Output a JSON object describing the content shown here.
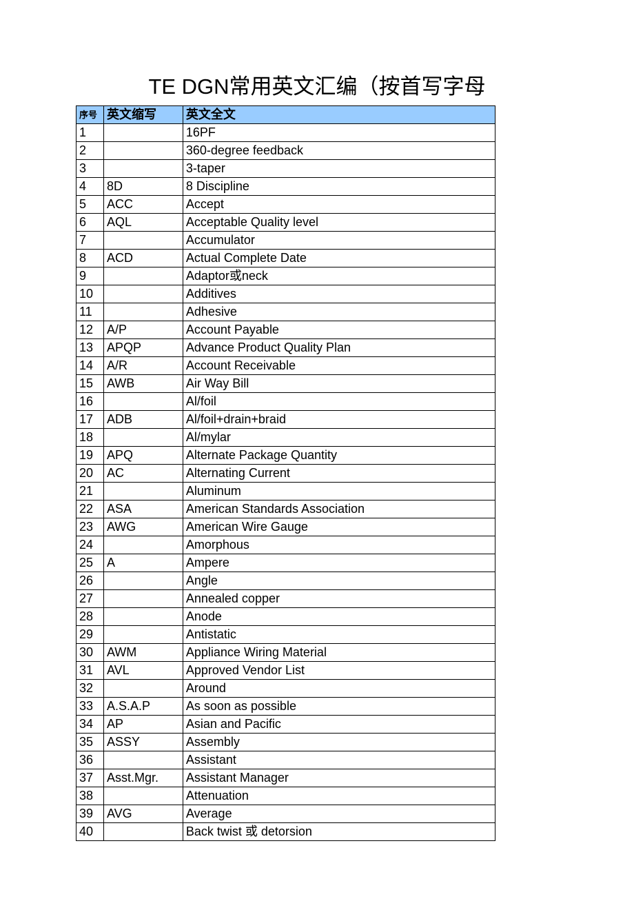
{
  "title": "TE DGN常用英文汇编（按首写字母",
  "headers": {
    "seq": "序号",
    "abbr": "英文缩写",
    "full": "英文全文"
  },
  "rows": [
    {
      "seq": "1",
      "abbr": "",
      "full": "16PF"
    },
    {
      "seq": "2",
      "abbr": "",
      "full": "360-degree feedback"
    },
    {
      "seq": "3",
      "abbr": "",
      "full": "3-taper"
    },
    {
      "seq": "4",
      "abbr": "8D",
      "full": "8 Discipline"
    },
    {
      "seq": "5",
      "abbr": "ACC",
      "full": "Accept"
    },
    {
      "seq": "6",
      "abbr": "AQL",
      "full": "Acceptable Quality level"
    },
    {
      "seq": "7",
      "abbr": "",
      "full": "Accumulator"
    },
    {
      "seq": "8",
      "abbr": "ACD",
      "full": "Actual Complete Date"
    },
    {
      "seq": "9",
      "abbr": "",
      "full": "Adaptor或neck"
    },
    {
      "seq": "10",
      "abbr": "",
      "full": "Additives"
    },
    {
      "seq": "11",
      "abbr": "",
      "full": "Adhesive"
    },
    {
      "seq": "12",
      "abbr": "A/P",
      "full": "Account Payable"
    },
    {
      "seq": "13",
      "abbr": "APQP",
      "full": "Advance Product Quality Plan"
    },
    {
      "seq": "14",
      "abbr": "A/R",
      "full": "Account Receivable"
    },
    {
      "seq": "15",
      "abbr": "AWB",
      "full": "Air Way Bill"
    },
    {
      "seq": "16",
      "abbr": "",
      "full": "Al/foil"
    },
    {
      "seq": "17",
      "abbr": "ADB",
      "full": "Al/foil+drain+braid"
    },
    {
      "seq": "18",
      "abbr": "",
      "full": "Al/mylar"
    },
    {
      "seq": "19",
      "abbr": "APQ",
      "full": "Alternate Package Quantity"
    },
    {
      "seq": "20",
      "abbr": "AC",
      "full": "Alternating Current"
    },
    {
      "seq": "21",
      "abbr": "",
      "full": "Aluminum"
    },
    {
      "seq": "22",
      "abbr": "ASA",
      "full": "American Standards Association"
    },
    {
      "seq": "23",
      "abbr": "AWG",
      "full": "American Wire Gauge"
    },
    {
      "seq": "24",
      "abbr": "",
      "full": "Amorphous"
    },
    {
      "seq": "25",
      "abbr": "A",
      "full": "Ampere"
    },
    {
      "seq": "26",
      "abbr": "",
      "full": "Angle"
    },
    {
      "seq": "27",
      "abbr": "",
      "full": "Annealed copper"
    },
    {
      "seq": "28",
      "abbr": "",
      "full": "Anode"
    },
    {
      "seq": "29",
      "abbr": "",
      "full": "Antistatic"
    },
    {
      "seq": "30",
      "abbr": "AWM",
      "full": "Appliance Wiring Material"
    },
    {
      "seq": "31",
      "abbr": "AVL",
      "full": "Approved Vendor List"
    },
    {
      "seq": "32",
      "abbr": "",
      "full": "Around"
    },
    {
      "seq": "33",
      "abbr": "A.S.A.P",
      "full": "As soon as possible"
    },
    {
      "seq": "34",
      "abbr": "AP",
      "full": "Asian and Pacific"
    },
    {
      "seq": "35",
      "abbr": "ASSY",
      "full": "Assembly"
    },
    {
      "seq": "36",
      "abbr": "",
      "full": "Assistant"
    },
    {
      "seq": "37",
      "abbr": "Asst.Mgr.",
      "full": "Assistant Manager"
    },
    {
      "seq": "38",
      "abbr": "",
      "full": "Attenuation"
    },
    {
      "seq": "39",
      "abbr": "AVG",
      "full": "Average"
    },
    {
      "seq": "40",
      "abbr": "",
      "full": "Back twist 或 detorsion"
    }
  ]
}
